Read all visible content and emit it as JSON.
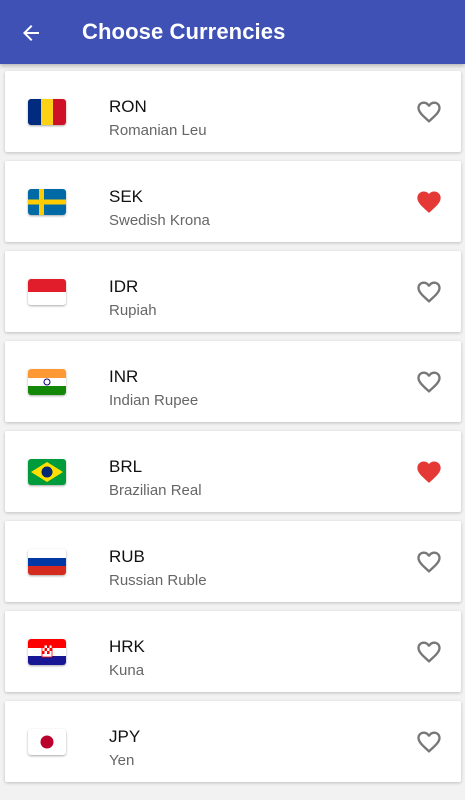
{
  "appbar": {
    "title": "Choose Currencies",
    "color": "#3f51b5"
  },
  "currencies": [
    {
      "code": "RON",
      "name": "Romanian Leu",
      "favorite": false,
      "flag": "romania-flag"
    },
    {
      "code": "SEK",
      "name": "Swedish Krona",
      "favorite": true,
      "flag": "sweden-flag"
    },
    {
      "code": "IDR",
      "name": "Rupiah",
      "favorite": false,
      "flag": "indonesia-flag"
    },
    {
      "code": "INR",
      "name": "Indian Rupee",
      "favorite": false,
      "flag": "india-flag"
    },
    {
      "code": "BRL",
      "name": "Brazilian Real",
      "favorite": true,
      "flag": "brazil-flag"
    },
    {
      "code": "RUB",
      "name": "Russian Ruble",
      "favorite": false,
      "flag": "russia-flag"
    },
    {
      "code": "HRK",
      "name": "Kuna",
      "favorite": false,
      "flag": "croatia-flag"
    },
    {
      "code": "JPY",
      "name": "Yen",
      "favorite": false,
      "flag": "japan-flag"
    }
  ],
  "colors": {
    "favorite_active": "#e53935",
    "favorite_inactive": "#777777"
  }
}
